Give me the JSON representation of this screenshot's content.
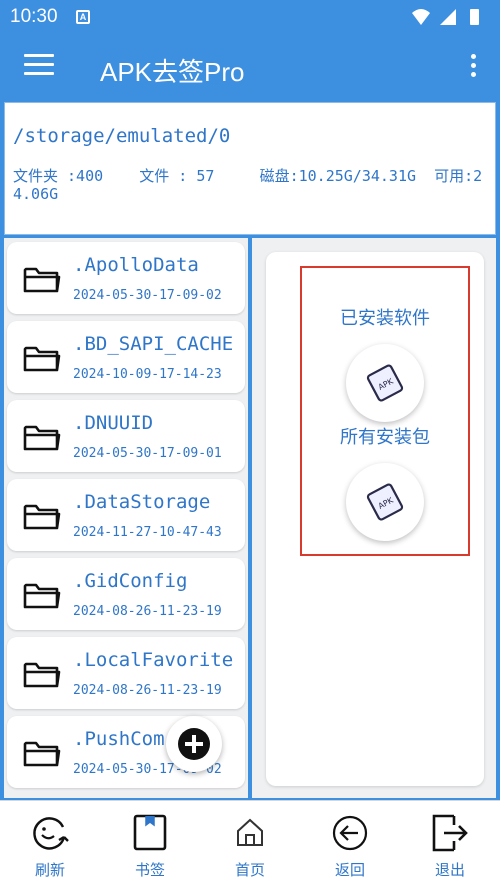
{
  "status_bar": {
    "time": "10:30",
    "notification_icon": "A",
    "icons": [
      "wifi-icon",
      "signal-icon",
      "battery-icon"
    ]
  },
  "app_bar": {
    "title": "APK去签Pro",
    "menu_icon": "hamburger-menu-icon",
    "more_icon": "more-vert-icon"
  },
  "path_panel": {
    "path": "/storage/emulated/0",
    "stats": "文件夹 :400    文件 : 57     磁盘:10.25G/34.31G  可用:24.06G"
  },
  "file_list": {
    "items": [
      {
        "name": ".ApolloData",
        "date": "2024-05-30-17-09-02"
      },
      {
        "name": ".BD_SAPI_CACHE",
        "date": "2024-10-09-17-14-23"
      },
      {
        "name": ".DNUUID",
        "date": "2024-05-30-17-09-01"
      },
      {
        "name": ".DataStorage",
        "date": "2024-11-27-10-47-43"
      },
      {
        "name": ".GidConfig",
        "date": "2024-08-26-11-23-19"
      },
      {
        "name": ".LocalFavorite",
        "date": "2024-08-26-11-23-19"
      },
      {
        "name": ".PushCom",
        "date": "2024-05-30-17-09-02"
      }
    ]
  },
  "quick_actions": {
    "installed_apps": {
      "label": "已安装软件",
      "icon": "APK"
    },
    "all_packages": {
      "label": "所有安装包",
      "icon": "APK"
    }
  },
  "bottom_nav": {
    "items": [
      {
        "label": "刷新",
        "icon": "refresh-face-icon"
      },
      {
        "label": "书签",
        "icon": "bookmark-icon"
      },
      {
        "label": "首页",
        "icon": "home-icon"
      },
      {
        "label": "返回",
        "icon": "back-icon"
      },
      {
        "label": "退出",
        "icon": "exit-icon"
      }
    ]
  },
  "colors": {
    "primary": "#3d8fe0",
    "text_blue": "#2f76c9",
    "highlight_red": "#d83a2e"
  }
}
